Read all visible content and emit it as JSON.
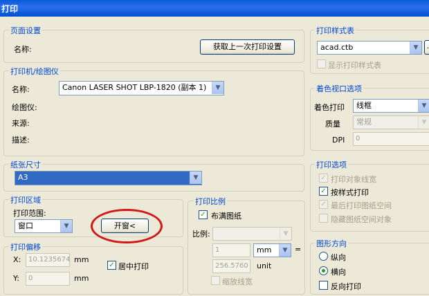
{
  "window": {
    "title": "打印"
  },
  "page_setup": {
    "title": "页面设置",
    "name_label": "名称:",
    "load_button": "获取上一次打印设置"
  },
  "printer": {
    "title": "打印机/绘图仪",
    "name_label": "名称:",
    "name_value": "Canon LASER SHOT LBP-1820 (副本 1)",
    "plotter_label": "绘图仪:",
    "location_label": "来源:",
    "description_label": "描述:"
  },
  "paper_size": {
    "title": "纸张尺寸",
    "value": "A3"
  },
  "plot_area": {
    "title": "打印区域",
    "range_label": "打印范围:",
    "range_value": "窗口",
    "window_button": "开窗<"
  },
  "plot_offset": {
    "title": "打印偏移",
    "x_label": "X:",
    "x_value": "10.1235674",
    "x_unit": "mm",
    "y_label": "Y:",
    "y_value": "0",
    "y_unit": "mm",
    "center_label": "居中打印"
  },
  "plot_scale": {
    "title": "打印比例",
    "fit_label": "布满图纸",
    "scale_label": "比例:",
    "scale_value": "",
    "value1": "1",
    "unit_select": "mm",
    "equals": "=",
    "value2": "256.5760",
    "unit_label": "unit",
    "lineweights_label": "缩放线宽"
  },
  "plot_style_table": {
    "title": "打印样式表",
    "value": "acad.ctb",
    "more_button": "...",
    "display_label": "显示打印样式表"
  },
  "shaded_viewport": {
    "title": "着色视口选项",
    "shade_label": "着色打印",
    "shade_value": "线框",
    "quality_label": "质量",
    "quality_value": "常规",
    "dpi_label": "DPI",
    "dpi_value": "0"
  },
  "plot_options": {
    "title": "打印选项",
    "items": [
      {
        "label": "打印对象线宽",
        "checked": true,
        "enabled": false
      },
      {
        "label": "按样式打印",
        "checked": true,
        "enabled": true
      },
      {
        "label": "最后打印图纸空间",
        "checked": true,
        "enabled": false
      },
      {
        "label": "隐藏图纸空间对象",
        "checked": false,
        "enabled": false
      }
    ]
  },
  "orientation": {
    "title": "图形方向",
    "portrait": "纵向",
    "landscape": "横向",
    "selected": "landscape",
    "upside_down": "反向打印"
  }
}
